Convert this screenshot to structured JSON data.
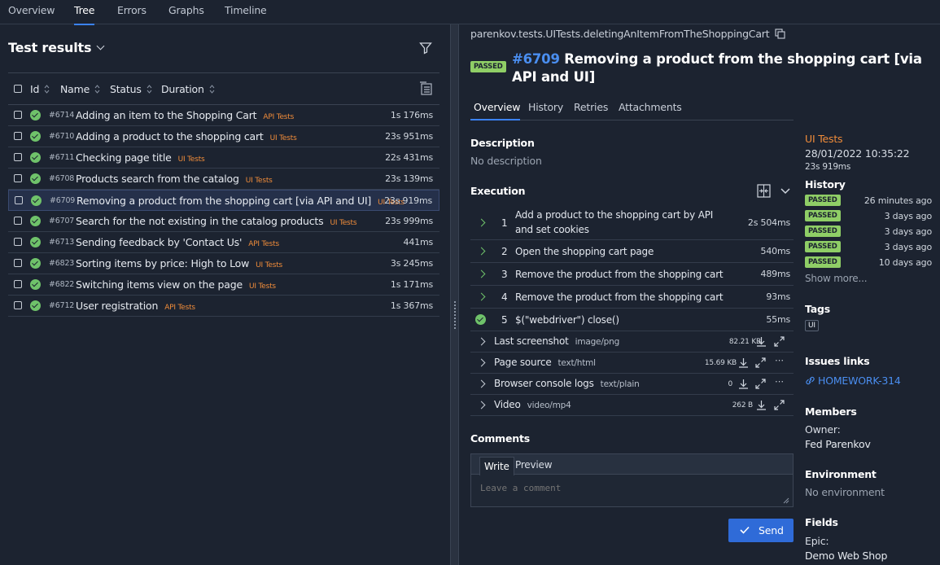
{
  "nav": {
    "tabs": [
      "Overview",
      "Tree",
      "Errors",
      "Graphs",
      "Timeline"
    ],
    "active": "Tree"
  },
  "tree": {
    "title": "Test results",
    "columns": {
      "id": "Id",
      "name": "Name",
      "status": "Status",
      "duration": "Duration"
    },
    "rows": [
      {
        "id": "#6714",
        "name": "Adding an item to the Shopping Cart",
        "tag": "API Tests",
        "duration": "1s 176ms"
      },
      {
        "id": "#6710",
        "name": "Adding a product to the shopping cart",
        "tag": "UI Tests",
        "duration": "23s 951ms"
      },
      {
        "id": "#6711",
        "name": "Checking page title",
        "tag": "UI Tests",
        "duration": "22s 431ms"
      },
      {
        "id": "#6708",
        "name": "Products search from the catalog",
        "tag": "UI Tests",
        "duration": "23s 139ms"
      },
      {
        "id": "#6709",
        "name": "Removing a product from the shopping cart [via API and UI]",
        "tag": "UI Tests",
        "duration": "23s 919ms"
      },
      {
        "id": "#6707",
        "name": "Search for the not existing in the catalog products",
        "tag": "UI Tests",
        "duration": "23s 999ms"
      },
      {
        "id": "#6713",
        "name": "Sending feedback by 'Contact Us'",
        "tag": "API Tests",
        "duration": "441ms"
      },
      {
        "id": "#6823",
        "name": "Sorting items by price: High to Low",
        "tag": "UI Tests",
        "duration": "3s 245ms"
      },
      {
        "id": "#6822",
        "name": "Switching items view on the page",
        "tag": "UI Tests",
        "duration": "1s 171ms"
      },
      {
        "id": "#6712",
        "name": "User registration",
        "tag": "API Tests",
        "duration": "1s 367ms"
      }
    ],
    "selected_index": 4
  },
  "detail": {
    "path": "parenkov.tests.UITests.deletingAnItemFromTheShoppingCart",
    "status": "PASSED",
    "number": "#6709",
    "title": "Removing a product from the shopping cart [via API and UI]",
    "tabs": [
      "Overview",
      "History",
      "Retries",
      "Attachments"
    ],
    "description_label": "Description",
    "description": "No description",
    "execution_label": "Execution",
    "steps": [
      {
        "n": "1",
        "text": "Add a product to the shopping cart by API and set cookies",
        "duration": "2s 504ms"
      },
      {
        "n": "2",
        "text": "Open the shopping cart page",
        "duration": "540ms"
      },
      {
        "n": "3",
        "text": "Remove the product from the shopping cart",
        "duration": "489ms"
      },
      {
        "n": "4",
        "text": "Remove the product from the shopping cart",
        "duration": "93ms"
      },
      {
        "n": "5",
        "text": "$(\"webdriver\") close()",
        "duration": "55ms"
      }
    ],
    "attachments": [
      {
        "name": "Last screenshot",
        "type": "image/png",
        "size": "82.21 KB"
      },
      {
        "name": "Page source",
        "type": "text/html",
        "size": "15.69 KB"
      },
      {
        "name": "Browser console logs",
        "type": "text/plain",
        "size": "0"
      },
      {
        "name": "Video",
        "type": "video/mp4",
        "size": "262 B"
      }
    ],
    "comments_label": "Comments",
    "comment_tabs": [
      "Write",
      "Preview"
    ],
    "comment_placeholder": "Leave a comment",
    "send_label": "Send"
  },
  "sidebar": {
    "suite": "UI Tests",
    "date": "28/01/2022 10:35:22",
    "duration": "23s 919ms",
    "history_label": "History",
    "history": [
      {
        "status": "PASSED",
        "time": "26 minutes ago"
      },
      {
        "status": "PASSED",
        "time": "3 days ago"
      },
      {
        "status": "PASSED",
        "time": "3 days ago"
      },
      {
        "status": "PASSED",
        "time": "3 days ago"
      },
      {
        "status": "PASSED",
        "time": "10 days ago"
      }
    ],
    "show_more": "Show more...",
    "tags_label": "Tags",
    "tag": "UI",
    "issues_label": "Issues links",
    "issue": "HOMEWORK-314",
    "members_label": "Members",
    "owner_label": "Owner:",
    "owner": "Fed Parenkov",
    "environment_label": "Environment",
    "environment": "No environment",
    "fields_label": "Fields",
    "field_key": "Epic:",
    "field_value": "Demo Web Shop"
  },
  "colors": {
    "accent": "#3b82f6",
    "passed": "#8fce66",
    "tag": "#f08c3a",
    "background": "#1c2330"
  }
}
